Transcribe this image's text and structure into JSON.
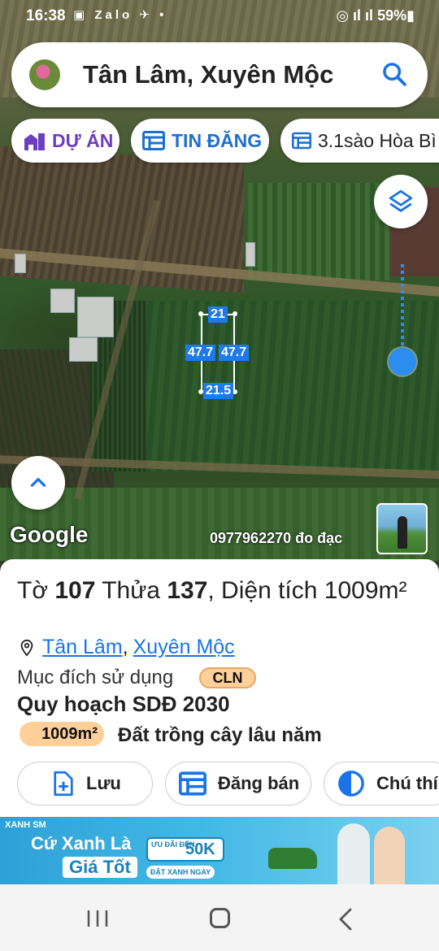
{
  "status_bar": {
    "time": "16:38",
    "notif_icons": "▣ Zalo ✈ •",
    "battery": "59%"
  },
  "search": {
    "query": "Tân Lâm, Xuyên Mộc"
  },
  "chips": [
    {
      "label": "DỰ ÁN"
    },
    {
      "label": "TIN ĐĂNG"
    },
    {
      "label": "3.1sào Hòa Bì"
    }
  ],
  "parcel": {
    "top": "21",
    "left": "47.7",
    "right": "47.7",
    "bottom": "21.5"
  },
  "map": {
    "brand": "Google",
    "phone_label": "0977962270 đo đạc"
  },
  "info": {
    "title_prefix": "Tờ",
    "sheet_no": "107",
    "plot_prefix": "Thửa",
    "plot_no": "137",
    "area_prefix": ", Diện tích",
    "area_value": "1009m²",
    "district": "Tân Lâm",
    "province": "Xuyên Mộc",
    "purpose_label": "Mục đích sử dụng",
    "purpose_code": "CLN",
    "plan_label": "Quy hoạch SDĐ 2030",
    "plan_area": "1009m²",
    "plan_type": "Đất trồng cây lâu năm"
  },
  "actions": [
    {
      "label": "Lưu",
      "icon": "add-file-icon"
    },
    {
      "label": "Đăng bán",
      "icon": "list-icon"
    },
    {
      "label": "Chú thí",
      "icon": "half-circle-icon"
    }
  ],
  "ad": {
    "brand": "XANH SM",
    "line1": "Cứ Xanh Là",
    "line2": "Giá Tốt",
    "promo_small": "ƯU ĐÃI ĐẾN",
    "promo_value": "50K",
    "cta": "ĐẶT XANH NGAY"
  },
  "colors": {
    "accent_blue": "#1a73e8",
    "project_purple": "#6b3fc0",
    "badge_orange": "#ffcf99"
  }
}
